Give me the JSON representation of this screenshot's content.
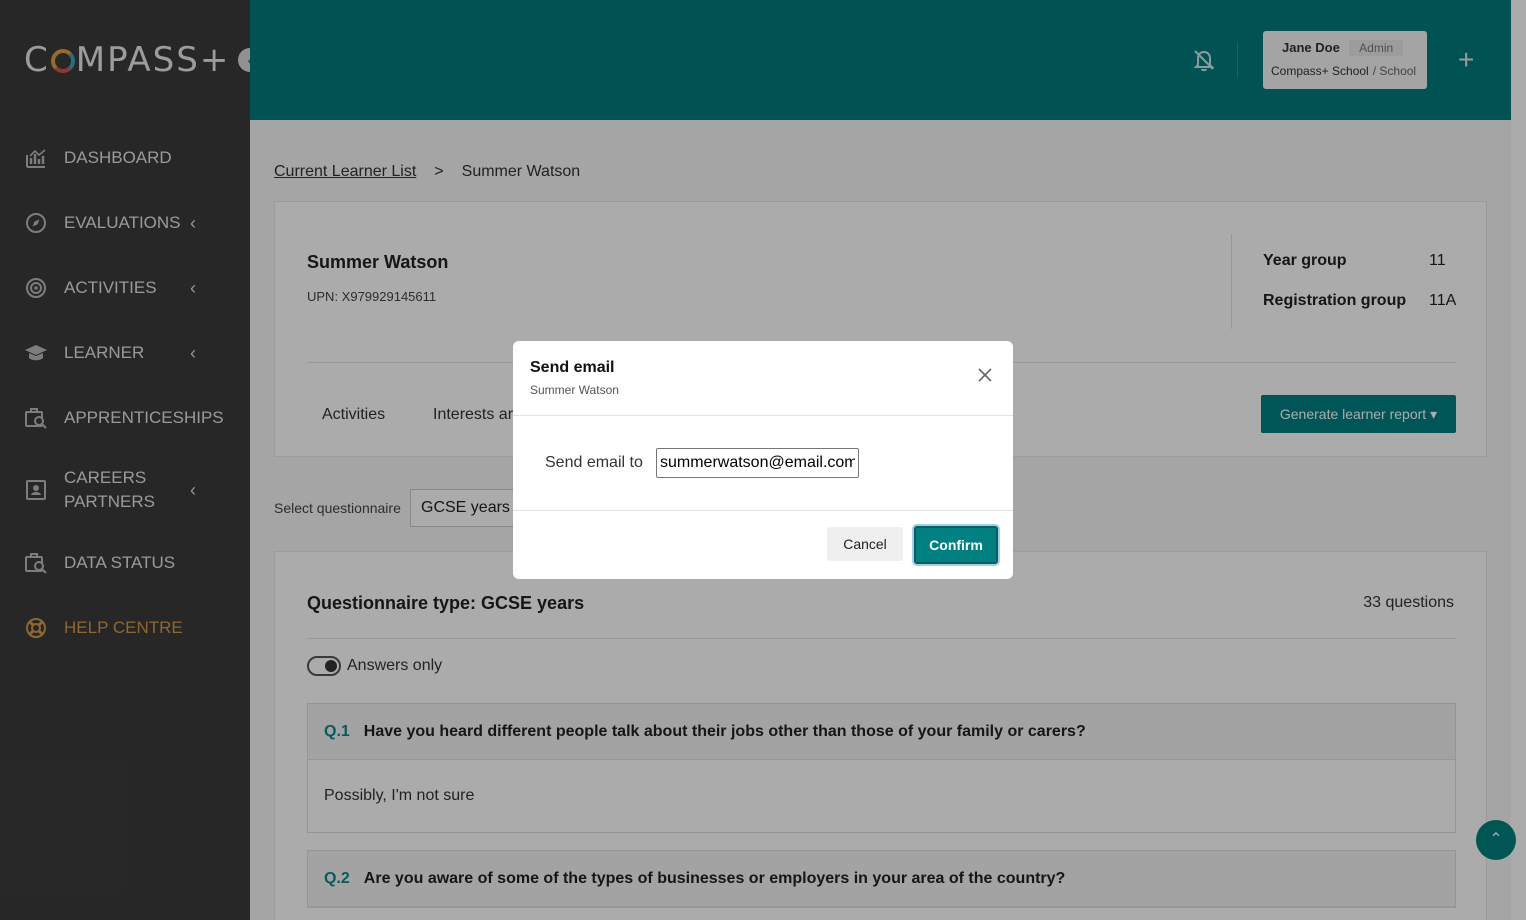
{
  "sidebar": {
    "logo_text": "COMPASS+",
    "collapse_glyph": "‹",
    "items": [
      {
        "label": "DASHBOARD",
        "icon": "chart-icon",
        "has_chevron": false
      },
      {
        "label": "EVALUATIONS",
        "icon": "compass-icon",
        "has_chevron": true
      },
      {
        "label": "ACTIVITIES",
        "icon": "target-icon",
        "has_chevron": true
      },
      {
        "label": "LEARNER",
        "icon": "graduation-cap-icon",
        "has_chevron": true
      },
      {
        "label": "APPRENTICESHIPS",
        "icon": "briefcase-search-icon",
        "has_chevron": false
      },
      {
        "label": "CAREERS PARTNERS",
        "icon": "contact-card-icon",
        "has_chevron": true
      },
      {
        "label": "DATA STATUS",
        "icon": "briefcase-search-icon",
        "has_chevron": false
      },
      {
        "label": "HELP CENTRE",
        "icon": "lifebuoy-icon",
        "has_chevron": false
      }
    ],
    "chevron_glyph": "‹"
  },
  "header": {
    "user_name": "Jane Doe",
    "user_role": "Admin",
    "org_name": "Compass+ School",
    "org_type": "/ School",
    "plus_glyph": "+"
  },
  "breadcrumb": {
    "parent": "Current Learner List",
    "separator": ">",
    "current": "Summer Watson"
  },
  "learner": {
    "name": "Summer Watson",
    "upn": "UPN: X979929145611",
    "year_group_label": "Year group",
    "year_group_value": "11",
    "registration_group_label": "Registration group",
    "registration_group_value": "11A"
  },
  "tabs": [
    {
      "label": "Activities"
    },
    {
      "label": "Interests ar"
    }
  ],
  "generate_button": "Generate learner report ▾",
  "questionnaire": {
    "select_label": "Select questionnaire",
    "selected": "GCSE years",
    "type_title": "Questionnaire type: GCSE years",
    "count": "33 questions",
    "answers_only_label": "Answers only",
    "questions": [
      {
        "number": "Q.1",
        "text": "Have you heard different people talk about their jobs other than those of your family or carers?",
        "answer": "Possibly, I'm not sure"
      },
      {
        "number": "Q.2",
        "text": "Are you aware of some of the types of businesses or employers in your area of the country?",
        "answer": ""
      }
    ]
  },
  "modal": {
    "title": "Send email",
    "subtitle": "Summer Watson",
    "email_label": "Send email to",
    "email_value": "summerwatson@email.com",
    "cancel_label": "Cancel",
    "confirm_label": "Confirm"
  },
  "scroll_top_glyph": "⌃",
  "colors": {
    "brand_teal": "#007c7b",
    "button_teal": "#008080",
    "sidebar_bg": "#3b3b3b",
    "help_orange": "#d49a4a"
  }
}
